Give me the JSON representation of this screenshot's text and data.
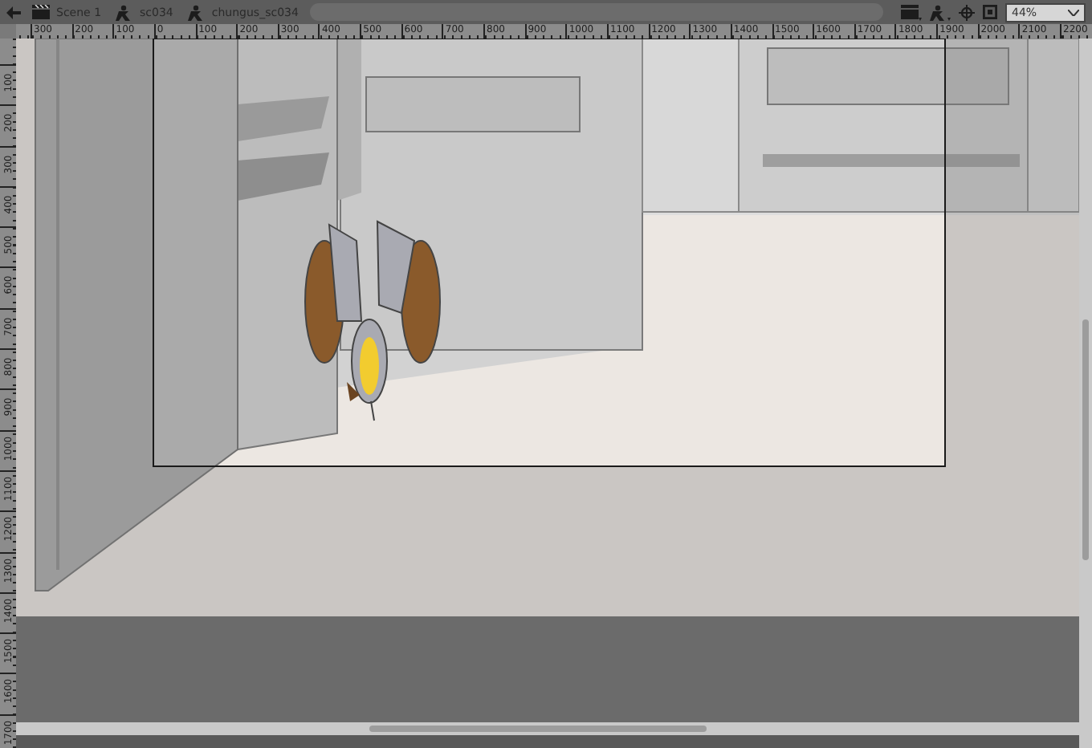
{
  "breadcrumbs": [
    {
      "label": "Scene 1",
      "kind": "scene"
    },
    {
      "label": "sc034",
      "kind": "symbol"
    },
    {
      "label": "chungus_sc034",
      "kind": "symbol"
    }
  ],
  "zoom": {
    "value": "44%"
  },
  "ruler_horizontal": {
    "labels": [
      "300",
      "200",
      "100",
      "0",
      "100",
      "200",
      "300",
      "400",
      "500",
      "600",
      "700",
      "800",
      "900",
      "1000",
      "1100",
      "1200",
      "1300",
      "1400",
      "1500",
      "1600",
      "1700",
      "1800",
      "1900",
      "2000",
      "2100",
      "2200"
    ]
  },
  "ruler_vertical": {
    "labels": [
      "100",
      "200",
      "300",
      "400",
      "500",
      "600",
      "700",
      "800",
      "900",
      "1000",
      "1100",
      "1200",
      "1300",
      "1400",
      "1500",
      "1600",
      "1700"
    ]
  }
}
